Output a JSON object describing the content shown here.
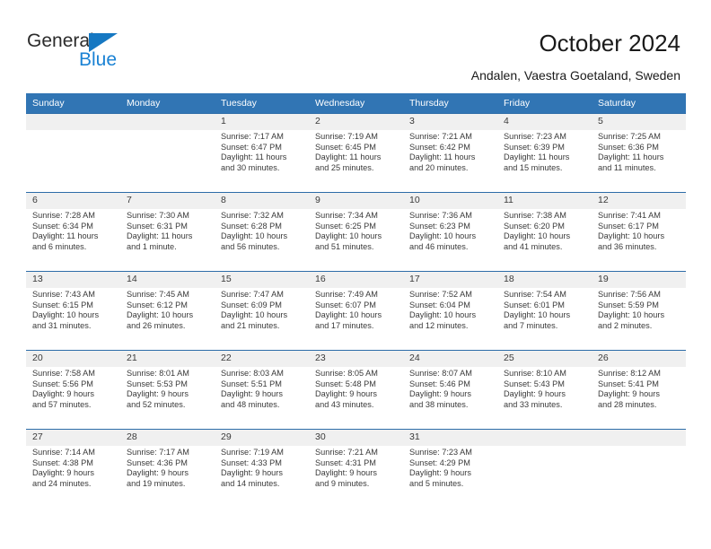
{
  "brand": {
    "name_part1": "General",
    "name_part2": "Blue",
    "triangle_color": "#1678c2",
    "blue_color": "#1a82d4",
    "dark_color": "#2b2b2b"
  },
  "header": {
    "title": "October 2024",
    "location": "Andalen, Vaestra Goetaland, Sweden"
  },
  "theme": {
    "header_bg": "#3175b4",
    "header_text": "#ffffff",
    "row_border": "#2d6ca8",
    "daynum_bg": "#f0f0f0",
    "body_text": "#3a3a3a"
  },
  "calendar": {
    "weekday_headers": [
      "Sunday",
      "Monday",
      "Tuesday",
      "Wednesday",
      "Thursday",
      "Friday",
      "Saturday"
    ],
    "weeks": [
      [
        {
          "day": "",
          "empty": true
        },
        {
          "day": "",
          "empty": true
        },
        {
          "day": "1",
          "sunrise": "Sunrise: 7:17 AM",
          "sunset": "Sunset: 6:47 PM",
          "daylight_line1": "Daylight: 11 hours",
          "daylight_line2": "and 30 minutes."
        },
        {
          "day": "2",
          "sunrise": "Sunrise: 7:19 AM",
          "sunset": "Sunset: 6:45 PM",
          "daylight_line1": "Daylight: 11 hours",
          "daylight_line2": "and 25 minutes."
        },
        {
          "day": "3",
          "sunrise": "Sunrise: 7:21 AM",
          "sunset": "Sunset: 6:42 PM",
          "daylight_line1": "Daylight: 11 hours",
          "daylight_line2": "and 20 minutes."
        },
        {
          "day": "4",
          "sunrise": "Sunrise: 7:23 AM",
          "sunset": "Sunset: 6:39 PM",
          "daylight_line1": "Daylight: 11 hours",
          "daylight_line2": "and 15 minutes."
        },
        {
          "day": "5",
          "sunrise": "Sunrise: 7:25 AM",
          "sunset": "Sunset: 6:36 PM",
          "daylight_line1": "Daylight: 11 hours",
          "daylight_line2": "and 11 minutes."
        }
      ],
      [
        {
          "day": "6",
          "sunrise": "Sunrise: 7:28 AM",
          "sunset": "Sunset: 6:34 PM",
          "daylight_line1": "Daylight: 11 hours",
          "daylight_line2": "and 6 minutes."
        },
        {
          "day": "7",
          "sunrise": "Sunrise: 7:30 AM",
          "sunset": "Sunset: 6:31 PM",
          "daylight_line1": "Daylight: 11 hours",
          "daylight_line2": "and 1 minute."
        },
        {
          "day": "8",
          "sunrise": "Sunrise: 7:32 AM",
          "sunset": "Sunset: 6:28 PM",
          "daylight_line1": "Daylight: 10 hours",
          "daylight_line2": "and 56 minutes."
        },
        {
          "day": "9",
          "sunrise": "Sunrise: 7:34 AM",
          "sunset": "Sunset: 6:25 PM",
          "daylight_line1": "Daylight: 10 hours",
          "daylight_line2": "and 51 minutes."
        },
        {
          "day": "10",
          "sunrise": "Sunrise: 7:36 AM",
          "sunset": "Sunset: 6:23 PM",
          "daylight_line1": "Daylight: 10 hours",
          "daylight_line2": "and 46 minutes."
        },
        {
          "day": "11",
          "sunrise": "Sunrise: 7:38 AM",
          "sunset": "Sunset: 6:20 PM",
          "daylight_line1": "Daylight: 10 hours",
          "daylight_line2": "and 41 minutes."
        },
        {
          "day": "12",
          "sunrise": "Sunrise: 7:41 AM",
          "sunset": "Sunset: 6:17 PM",
          "daylight_line1": "Daylight: 10 hours",
          "daylight_line2": "and 36 minutes."
        }
      ],
      [
        {
          "day": "13",
          "sunrise": "Sunrise: 7:43 AM",
          "sunset": "Sunset: 6:15 PM",
          "daylight_line1": "Daylight: 10 hours",
          "daylight_line2": "and 31 minutes."
        },
        {
          "day": "14",
          "sunrise": "Sunrise: 7:45 AM",
          "sunset": "Sunset: 6:12 PM",
          "daylight_line1": "Daylight: 10 hours",
          "daylight_line2": "and 26 minutes."
        },
        {
          "day": "15",
          "sunrise": "Sunrise: 7:47 AM",
          "sunset": "Sunset: 6:09 PM",
          "daylight_line1": "Daylight: 10 hours",
          "daylight_line2": "and 21 minutes."
        },
        {
          "day": "16",
          "sunrise": "Sunrise: 7:49 AM",
          "sunset": "Sunset: 6:07 PM",
          "daylight_line1": "Daylight: 10 hours",
          "daylight_line2": "and 17 minutes."
        },
        {
          "day": "17",
          "sunrise": "Sunrise: 7:52 AM",
          "sunset": "Sunset: 6:04 PM",
          "daylight_line1": "Daylight: 10 hours",
          "daylight_line2": "and 12 minutes."
        },
        {
          "day": "18",
          "sunrise": "Sunrise: 7:54 AM",
          "sunset": "Sunset: 6:01 PM",
          "daylight_line1": "Daylight: 10 hours",
          "daylight_line2": "and 7 minutes."
        },
        {
          "day": "19",
          "sunrise": "Sunrise: 7:56 AM",
          "sunset": "Sunset: 5:59 PM",
          "daylight_line1": "Daylight: 10 hours",
          "daylight_line2": "and 2 minutes."
        }
      ],
      [
        {
          "day": "20",
          "sunrise": "Sunrise: 7:58 AM",
          "sunset": "Sunset: 5:56 PM",
          "daylight_line1": "Daylight: 9 hours",
          "daylight_line2": "and 57 minutes."
        },
        {
          "day": "21",
          "sunrise": "Sunrise: 8:01 AM",
          "sunset": "Sunset: 5:53 PM",
          "daylight_line1": "Daylight: 9 hours",
          "daylight_line2": "and 52 minutes."
        },
        {
          "day": "22",
          "sunrise": "Sunrise: 8:03 AM",
          "sunset": "Sunset: 5:51 PM",
          "daylight_line1": "Daylight: 9 hours",
          "daylight_line2": "and 48 minutes."
        },
        {
          "day": "23",
          "sunrise": "Sunrise: 8:05 AM",
          "sunset": "Sunset: 5:48 PM",
          "daylight_line1": "Daylight: 9 hours",
          "daylight_line2": "and 43 minutes."
        },
        {
          "day": "24",
          "sunrise": "Sunrise: 8:07 AM",
          "sunset": "Sunset: 5:46 PM",
          "daylight_line1": "Daylight: 9 hours",
          "daylight_line2": "and 38 minutes."
        },
        {
          "day": "25",
          "sunrise": "Sunrise: 8:10 AM",
          "sunset": "Sunset: 5:43 PM",
          "daylight_line1": "Daylight: 9 hours",
          "daylight_line2": "and 33 minutes."
        },
        {
          "day": "26",
          "sunrise": "Sunrise: 8:12 AM",
          "sunset": "Sunset: 5:41 PM",
          "daylight_line1": "Daylight: 9 hours",
          "daylight_line2": "and 28 minutes."
        }
      ],
      [
        {
          "day": "27",
          "sunrise": "Sunrise: 7:14 AM",
          "sunset": "Sunset: 4:38 PM",
          "daylight_line1": "Daylight: 9 hours",
          "daylight_line2": "and 24 minutes."
        },
        {
          "day": "28",
          "sunrise": "Sunrise: 7:17 AM",
          "sunset": "Sunset: 4:36 PM",
          "daylight_line1": "Daylight: 9 hours",
          "daylight_line2": "and 19 minutes."
        },
        {
          "day": "29",
          "sunrise": "Sunrise: 7:19 AM",
          "sunset": "Sunset: 4:33 PM",
          "daylight_line1": "Daylight: 9 hours",
          "daylight_line2": "and 14 minutes."
        },
        {
          "day": "30",
          "sunrise": "Sunrise: 7:21 AM",
          "sunset": "Sunset: 4:31 PM",
          "daylight_line1": "Daylight: 9 hours",
          "daylight_line2": "and 9 minutes."
        },
        {
          "day": "31",
          "sunrise": "Sunrise: 7:23 AM",
          "sunset": "Sunset: 4:29 PM",
          "daylight_line1": "Daylight: 9 hours",
          "daylight_line2": "and 5 minutes."
        },
        {
          "day": "",
          "empty": true
        },
        {
          "day": "",
          "empty": true
        }
      ]
    ]
  }
}
